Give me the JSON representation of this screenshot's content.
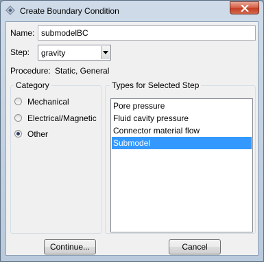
{
  "window": {
    "title": "Create Boundary Condition"
  },
  "form": {
    "name_label": "Name:",
    "name_value": "submodelBC",
    "step_label": "Step:",
    "step_value": "gravity",
    "procedure_label": "Procedure:",
    "procedure_value": "Static, General"
  },
  "category": {
    "title": "Category",
    "options": [
      {
        "label": "Mechanical",
        "checked": false
      },
      {
        "label": "Electrical/Magnetic",
        "checked": false
      },
      {
        "label": "Other",
        "checked": true
      }
    ]
  },
  "types": {
    "title": "Types for Selected Step",
    "items": [
      {
        "label": "Pore pressure",
        "selected": false
      },
      {
        "label": "Fluid cavity pressure",
        "selected": false
      },
      {
        "label": "Connector material flow",
        "selected": false
      },
      {
        "label": "Submodel",
        "selected": true
      }
    ]
  },
  "buttons": {
    "continue": "Continue...",
    "cancel": "Cancel"
  },
  "colors": {
    "selection": "#3399ff",
    "close_button": "#c43f25"
  }
}
